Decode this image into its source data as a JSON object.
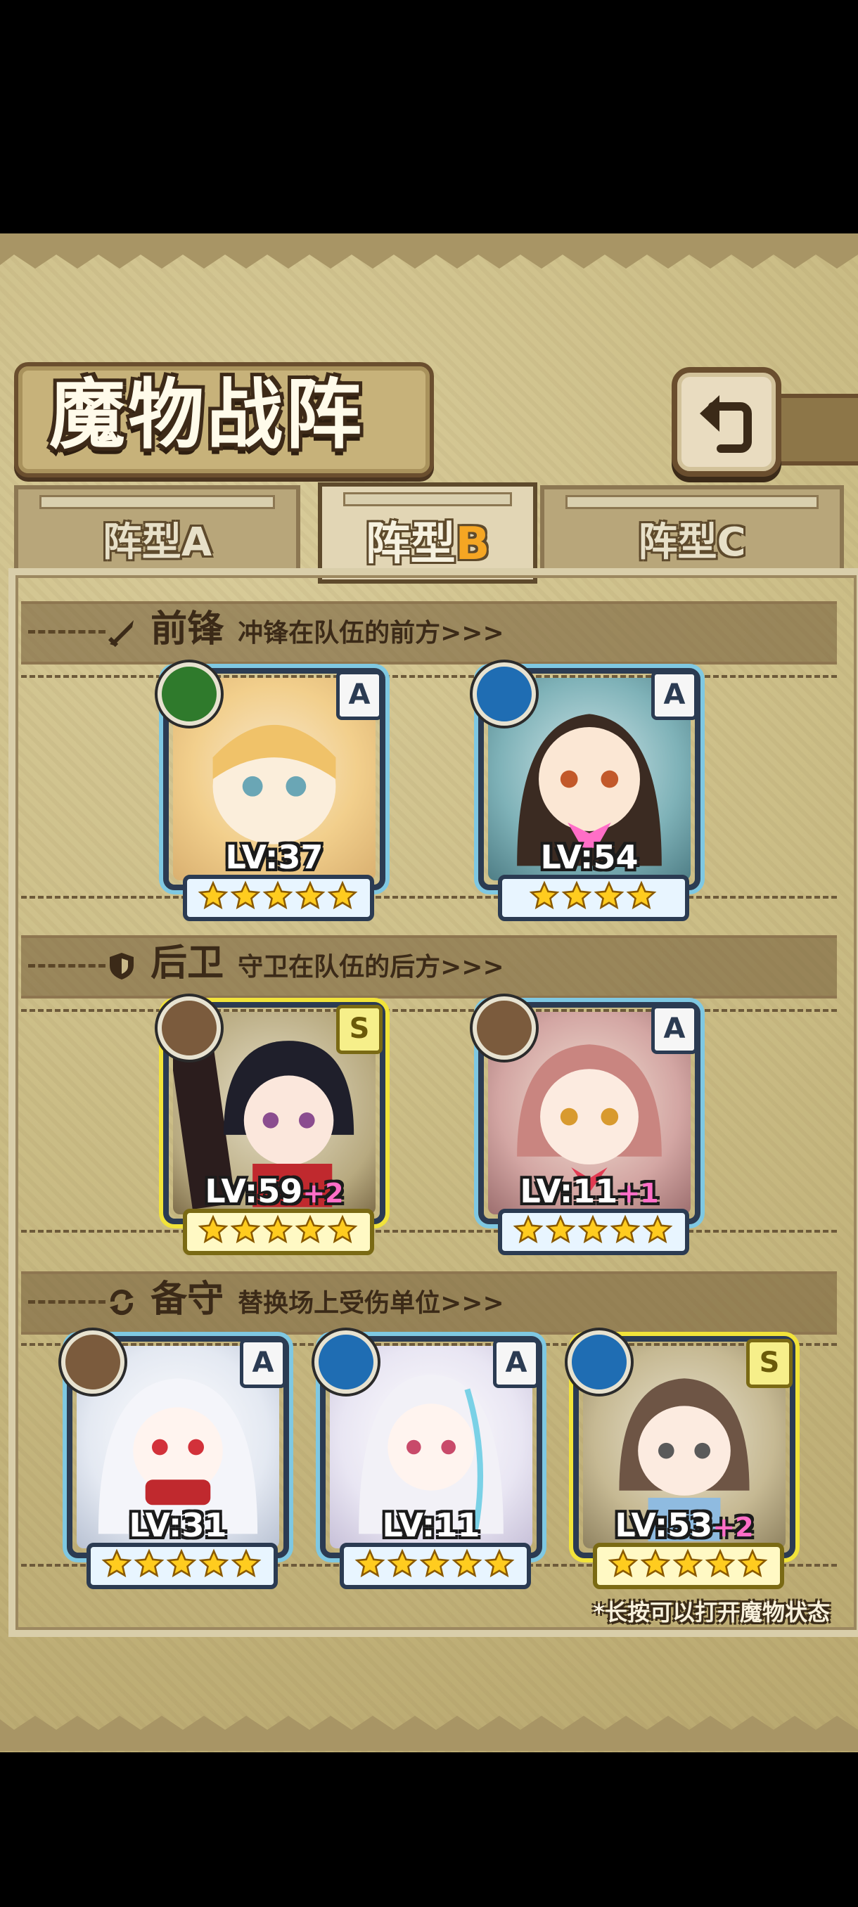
{
  "title": "魔物战阵",
  "tabs": [
    {
      "prefix": "阵型",
      "letter": "A",
      "active": false
    },
    {
      "prefix": "阵型",
      "letter": "B",
      "active": true
    },
    {
      "prefix": "阵型",
      "letter": "C",
      "active": false
    }
  ],
  "sections": {
    "front": {
      "label": "前锋",
      "sub": "冲锋在队伍的前方>>>",
      "icon": "sword-icon"
    },
    "rear": {
      "label": "后卫",
      "sub": "守卫在队伍的后方>>>",
      "icon": "shield-icon"
    },
    "reserve": {
      "label": "备守",
      "sub": "替换场上受伤单位>>>",
      "icon": "swap-icon"
    }
  },
  "monsters": {
    "front": [
      {
        "lv": "LV:37",
        "plus": "",
        "rank": "A",
        "element": "leaf-icon",
        "stars": 5
      },
      {
        "lv": "LV:54",
        "plus": "",
        "rank": "A",
        "element": "water-icon",
        "stars": 4
      }
    ],
    "rear": [
      {
        "lv": "LV:59",
        "plus": "+2",
        "rank": "S",
        "element": "earth-icon",
        "stars": 5
      },
      {
        "lv": "LV:11",
        "plus": "+1",
        "rank": "A",
        "element": "earth-icon",
        "stars": 5
      }
    ],
    "reserve": [
      {
        "lv": "LV:31",
        "plus": "",
        "rank": "A",
        "element": "earth-icon",
        "stars": 5
      },
      {
        "lv": "LV:11",
        "plus": "",
        "rank": "A",
        "element": "water-icon",
        "stars": 5
      },
      {
        "lv": "LV:53",
        "plus": "+2",
        "rank": "S",
        "element": "water-icon",
        "stars": 5
      }
    ]
  },
  "hint": "*长按可以打开魔物状态",
  "colors": {
    "accent_tab_letter": "#f5a623",
    "frame_blue": "#7fc8e2",
    "frame_gold": "#f1e33a",
    "plus_pink": "#ff6ec7"
  }
}
